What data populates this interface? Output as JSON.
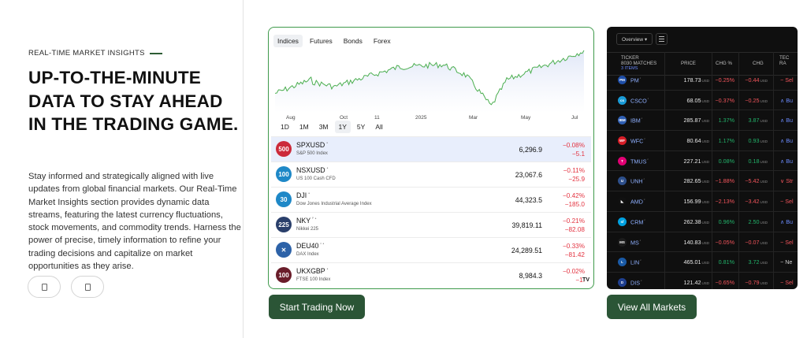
{
  "hero": {
    "eyebrow": "REAL-TIME MARKET INSIGHTS",
    "headline": "UP-TO-THE-MINUTE DATA TO STAY AHEAD IN THE TRADING GAME.",
    "body": "Stay informed and strategically aligned with live updates from global financial markets. Our Real-Time Market Insights section provides dynamic data streams, featuring the latest currency fluctuations, stock movements, and commodity trends. Harness the power of precise, timely information to refine your trading decisions and capitalize on market opportunities as they arise."
  },
  "overview_widget": {
    "tabs": [
      "Indices",
      "Futures",
      "Bonds",
      "Forex"
    ],
    "active_tab": "Indices",
    "axis_labels": [
      "Aug",
      "Oct",
      "11",
      "2025",
      "Mar",
      "May",
      "Jul"
    ],
    "ranges": [
      "1D",
      "1M",
      "3M",
      "1Y",
      "5Y",
      "All"
    ],
    "active_range": "1Y",
    "symbols": [
      {
        "badge": "500",
        "badge_color": "#cc2a3a",
        "ticker": "SPXUSD",
        "mark": "•",
        "name": "S&P 500 Index",
        "price": "6,296.9",
        "chg_pct": "−0.08%",
        "chg": "−5.1"
      },
      {
        "badge": "100",
        "badge_color": "#1e88c7",
        "ticker": "NSXUSD",
        "mark": "•",
        "name": "US 100 Cash CFD",
        "price": "23,067.6",
        "chg_pct": "−0.11%",
        "chg": "−25.9"
      },
      {
        "badge": "30",
        "badge_color": "#1e88c7",
        "ticker": "DJI",
        "mark": "•",
        "name": "Dow Jones Industrial Average Index",
        "price": "44,323.5",
        "chg_pct": "−0.42%",
        "chg": "−185.0"
      },
      {
        "badge": "225",
        "badge_color": "#2a3f6b",
        "ticker": "NKY",
        "mark": "ᴾ •",
        "name": "Nikkei 225",
        "price": "39,819.11",
        "chg_pct": "−0.21%",
        "chg": "−82.08"
      },
      {
        "badge": "✕",
        "badge_color": "#2d62a8",
        "ticker": "DEU40",
        "mark": "ᶜ •",
        "name": "DAX Index",
        "price": "24,289.51",
        "chg_pct": "−0.33%",
        "chg": "−81.42"
      },
      {
        "badge": "100",
        "badge_color": "#6a1d2a",
        "ticker": "UKXGBP",
        "mark": "•",
        "name": "FTSE 100 Index",
        "price": "8,984.3",
        "chg_pct": "−0.02%",
        "chg": "−1."
      }
    ],
    "watermark": "TV",
    "series_color": "#4caf50"
  },
  "screener": {
    "dropdown_label": "Overview ▾",
    "headers": {
      "ticker": "TICKER",
      "matches": "8030 MATCHES",
      "items": "3 ITEMS",
      "price": "PRICE",
      "chg_pct": "CHG %",
      "chg": "CHG",
      "tech_top": "TEC",
      "tech_bottom": "RA"
    },
    "currency": "USD",
    "rows": [
      {
        "sym": "PM",
        "logo_color": "#1f4fa8",
        "logo": "PM",
        "price": "178.73",
        "chg_pct": "−0.25%",
        "chg": "−0.44",
        "dir": "neg",
        "tech": "− Sel",
        "tech_class": "sell"
      },
      {
        "sym": "CSCO",
        "logo_color": "#1a9bd7",
        "logo": "cs",
        "price": "68.05",
        "chg_pct": "−0.37%",
        "chg": "−0.25",
        "dir": "neg",
        "tech": "∧ Bu",
        "tech_class": "buy"
      },
      {
        "sym": "IBM",
        "logo_color": "#2f5fb3",
        "logo": "IBM",
        "price": "285.87",
        "chg_pct": "1.37%",
        "chg": "3.87",
        "dir": "pos",
        "tech": "∧ Bu",
        "tech_class": "buy"
      },
      {
        "sym": "WFC",
        "logo_color": "#d71e28",
        "logo": "WF",
        "price": "80.64",
        "chg_pct": "1.17%",
        "chg": "0.93",
        "dir": "pos",
        "tech": "∧ Bu",
        "tech_class": "buy"
      },
      {
        "sym": "TMUS",
        "logo_color": "#e20074",
        "logo": "T",
        "price": "227.21",
        "chg_pct": "0.08%",
        "chg": "0.18",
        "dir": "pos",
        "tech": "∧ Bu",
        "tech_class": "buy"
      },
      {
        "sym": "UNH",
        "logo_color": "#2d4f8b",
        "logo": "U",
        "price": "282.65",
        "chg_pct": "−1.88%",
        "chg": "−5.42",
        "dir": "neg",
        "tech": "∨ Str",
        "tech_class": "sell"
      },
      {
        "sym": "AMD",
        "logo_color": "#111111",
        "logo": "◣",
        "price": "156.99",
        "chg_pct": "−2.13%",
        "chg": "−3.42",
        "dir": "neg",
        "tech": "− Sel",
        "tech_class": "sell"
      },
      {
        "sym": "CRM",
        "logo_color": "#00a1e0",
        "logo": "sf",
        "price": "262.38",
        "chg_pct": "0.96%",
        "chg": "2.50",
        "dir": "pos",
        "tech": "∧ Bu",
        "tech_class": "buy"
      },
      {
        "sym": "MS",
        "logo_color": "#1c1c1c",
        "logo": "MS",
        "price": "140.83",
        "chg_pct": "−0.05%",
        "chg": "−0.07",
        "dir": "neg",
        "tech": "− Sel",
        "tech_class": "sell"
      },
      {
        "sym": "LIN",
        "logo_color": "#1a5aa6",
        "logo": "L",
        "price": "465.01",
        "chg_pct": "0.81%",
        "chg": "3.72",
        "dir": "pos",
        "tech": "− Ne",
        "tech_class": "neu"
      },
      {
        "sym": "DIS",
        "logo_color": "#1f3f8f",
        "logo": "D",
        "price": "121.42",
        "chg_pct": "−0.65%",
        "chg": "−0.79",
        "dir": "neg",
        "tech": "− Sel",
        "tech_class": "sell"
      }
    ]
  },
  "buttons": {
    "start_trading": "Start Trading Now",
    "view_markets": "View All Markets"
  },
  "colors": {
    "brand_green": "#2b5536",
    "card_border": "#3f9a4b",
    "positive": "#22b36a",
    "negative": "#f2545b"
  }
}
